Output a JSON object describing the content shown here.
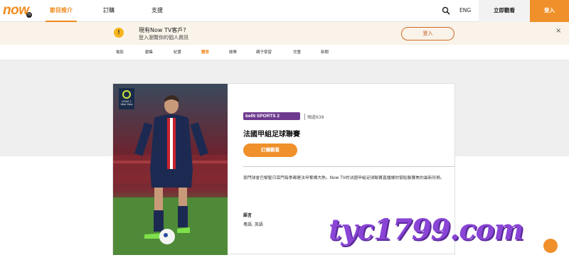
{
  "header": {
    "logo": "now",
    "logo_badge": "TV",
    "nav": [
      {
        "label": "節目推介",
        "active": true
      },
      {
        "label": "訂購",
        "active": false
      },
      {
        "label": "支援",
        "active": false
      }
    ],
    "search_icon": "search-icon",
    "lang": "ENG",
    "watch_now": "立即觀看",
    "login": "登入"
  },
  "banner": {
    "icon_glyph": "!",
    "title": "現有Now TV客戶?",
    "subtitle": "登入瀏覽你的個人資訊",
    "login_button": "登入",
    "close": "×"
  },
  "categories": [
    {
      "label": "電影",
      "active": false
    },
    {
      "label": "劇集",
      "active": false
    },
    {
      "label": "紀實",
      "active": false
    },
    {
      "label": "體育",
      "active": true
    },
    {
      "label": "娛樂",
      "active": false
    },
    {
      "label": "親子學習",
      "active": false
    },
    {
      "label": "兒童",
      "active": false
    },
    {
      "label": "新聞",
      "active": false
    }
  ],
  "program": {
    "badge": "LIGUE 1 Uber Eats",
    "channel_logo": "beIN SPORTS 2",
    "channel_number": "頻道639",
    "title": "法國甲組足球聯賽",
    "watch_button": "訂購觀看",
    "description": "豪門球會巴黎聖日耳門每季都是法甲奪標大熱。Now TV的法國甲組足球聯賽直播讓你緊貼聯賽焦的最新形勢。",
    "language_label": "語言",
    "language_value": "粵語, 英語"
  },
  "watermark": "tyc1799.com",
  "colors": {
    "accent": "#f0902a",
    "banner_bg": "#f9f3e9",
    "channel": "#6e3a8f",
    "watermark": "#8a45d6"
  }
}
